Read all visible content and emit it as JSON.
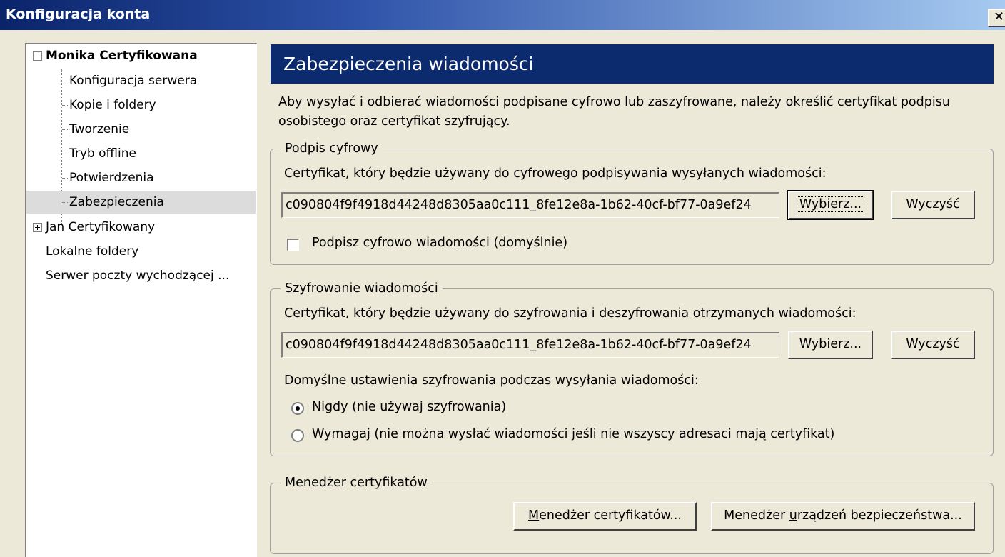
{
  "window": {
    "title": "Konfiguracja konta",
    "close_glyph": "✕"
  },
  "tree": {
    "accounts": [
      {
        "name": "Monika Certyfikowana",
        "expanded": true,
        "children": [
          "Konfiguracja serwera",
          "Kopie i foldery",
          "Tworzenie",
          "Tryb offline",
          "Potwierdzenia",
          "Zabezpieczenia"
        ]
      },
      {
        "name": "Jan Certyfikowany",
        "expanded": false
      }
    ],
    "local_folders": "Lokalne foldery",
    "outgoing_server": "Serwer poczty wychodzącej ...",
    "selected": "Zabezpieczenia"
  },
  "panel": {
    "title": "Zabezpieczenia wiadomości",
    "description": "Aby wysyłać i odbierać wiadomości podpisane cyfrowo lub zaszyfrowane, należy określić certyfikat podpisu osobistego oraz certyfikat szyfrujący."
  },
  "signing": {
    "legend": "Podpis cyfrowy",
    "cert_label": "Certyfikat, który będzie używany do cyfrowego podpisywania wysyłanych wiadomości:",
    "cert_value": "c090804f9f4918d44248d8305aa0c111_8fe12e8a-1b62-40cf-bf77-0a9ef24",
    "select_button": "Wybierz...",
    "clear_button": "Wyczyść",
    "sign_checkbox_label": "Podpisz cyfrowo wiadomości (domyślnie)",
    "sign_checked": false
  },
  "encryption": {
    "legend": "Szyfrowanie wiadomości",
    "cert_label": "Certyfikat, który będzie używany do szyfrowania i deszyfrowania otrzymanych wiadomości:",
    "cert_value": "c090804f9f4918d44248d8305aa0c111_8fe12e8a-1b62-40cf-bf77-0a9ef24",
    "select_button": "Wybierz...",
    "clear_button": "Wyczyść",
    "default_label": "Domyślne ustawienia szyfrowania podczas wysyłania wiadomości:",
    "option_never": "Nigdy (nie używaj szyfrowania)",
    "option_require": "Wymagaj (nie można wysłać wiadomości jeśli nie wszyscy adresaci mają certyfikat)",
    "selected_option": "never"
  },
  "cert_manager": {
    "legend": "Menedżer certyfikatów",
    "cert_manager_button_pre": "",
    "cert_manager_button_accel": "M",
    "cert_manager_button_post": "enedżer certyfikatów...",
    "device_manager_button_pre": "Menedżer ",
    "device_manager_button_accel": "u",
    "device_manager_button_post": "rządzeń bezpieczeństwa..."
  },
  "colors": {
    "header_bg": "#0b2b6e",
    "dialog_bg": "#ece9d8",
    "selection_bg": "#dcdcdc"
  }
}
